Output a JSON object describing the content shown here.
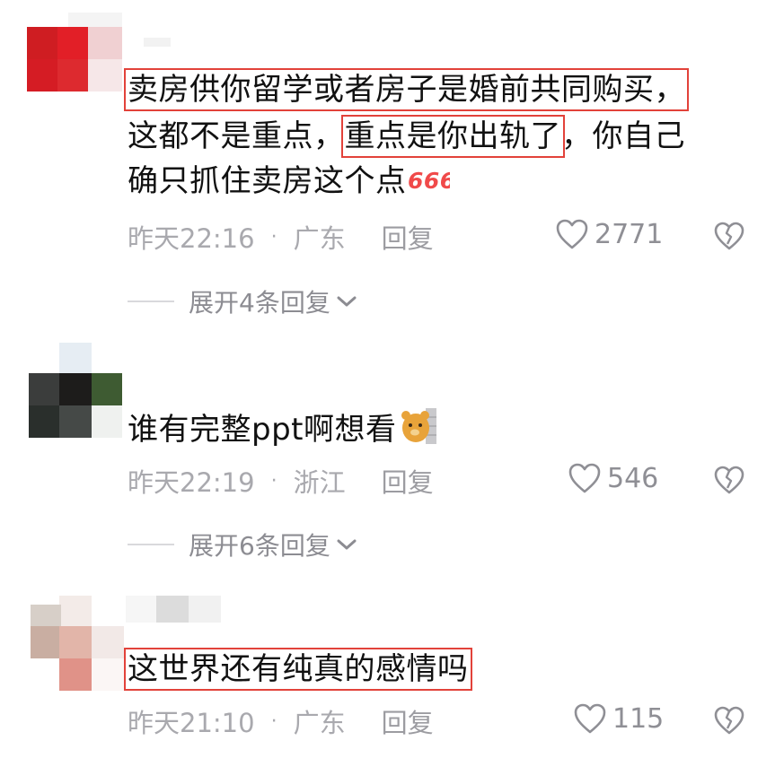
{
  "comments": [
    {
      "text_lines": [
        [
          "卖房供你留学或者房子是婚前共同购买，"
        ],
        [
          "这都不是重点，",
          "重点是你出轨了",
          "，你自己"
        ],
        [
          "确只抓住卖房这个点"
        ]
      ],
      "time": "昨天22:16",
      "location": "广东",
      "reply_label": "回复",
      "likes": "2771",
      "expand_label": "展开4条回复",
      "emoji": "666-emoji"
    },
    {
      "text": "谁有完整ppt啊想看",
      "time": "昨天22:19",
      "location": "浙江",
      "reply_label": "回复",
      "likes": "546",
      "expand_label": "展开6条回复",
      "emoji": "peeking-bear-emoji"
    },
    {
      "text": "这世界还有纯真的感情吗",
      "time": "昨天21:10",
      "location": "广东",
      "reply_label": "回复",
      "likes": "115"
    }
  ],
  "separator_dot": "·",
  "icons": {
    "like": "heart-outline-icon",
    "dislike": "broken-heart-icon",
    "expand": "chevron-down-icon"
  },
  "colors": {
    "highlight_box": "#e2423a",
    "meta_text": "#a9a9ae",
    "main_text": "#111111"
  },
  "emoji_666_text": "666"
}
